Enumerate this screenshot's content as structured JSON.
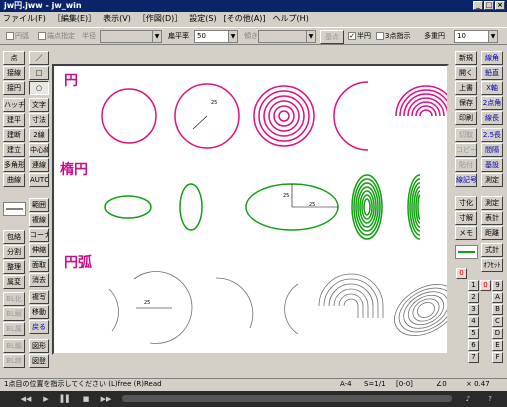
{
  "window": {
    "title": "jw円.jww - jw_win",
    "controls": [
      "_",
      "□",
      "×"
    ]
  },
  "menu": [
    "ファイル(F)",
    "［編集(E)］",
    "表示(V)",
    "［作図(D)］",
    "設定(S)",
    "[その他(A)]",
    "ヘルプ(H)"
  ],
  "toolbar": {
    "enkohai": "円弧",
    "tanten": "端点指定",
    "hankei": "半径",
    "henpei_label": "扁平率",
    "henpei_value": "50",
    "kakudo_label": "傾き",
    "sansho": "基点",
    "hanen": "半円",
    "sanshi": "3点指示",
    "taju_label": "多重円",
    "taju_value": "10"
  },
  "left_tools": [
    [
      "点",
      "／"
    ],
    [
      "接線",
      "□"
    ],
    [
      "接円",
      "○"
    ],
    [
      "ハッチ",
      "文字"
    ],
    [
      "建平",
      "寸法"
    ],
    [
      "建断",
      "2線"
    ],
    [
      "建立",
      "中心線"
    ],
    [
      "多角形",
      "連線"
    ],
    [
      "曲線",
      "AUTO"
    ],
    [
      "範囲"
    ],
    [
      "複線"
    ],
    [
      "包絡",
      "コーナー"
    ],
    [
      "分割",
      "伸縮"
    ],
    [
      "整理",
      "面取"
    ],
    [
      "属変",
      "消去"
    ],
    [
      "BL化",
      "複写"
    ],
    [
      "BL解",
      "移動"
    ],
    [
      "BL属",
      "戻る"
    ],
    [
      "BL編",
      "図形"
    ],
    [
      "BL終",
      "図登"
    ]
  ],
  "right_tools": [
    [
      "新規",
      "開く",
      "上書",
      "保存",
      "印刷",
      "切取",
      "コピー",
      "貼付",
      "線記号"
    ],
    [
      "線角",
      "鉛直",
      "X軸",
      "2点角",
      "線長",
      "2.5長",
      "間隔",
      "基設"
    ],
    [
      "寸化",
      "寸解",
      "メモ"
    ],
    [
      "測定",
      "表計",
      "距離",
      "式計",
      "ｵﾌｾｯﾄ"
    ]
  ],
  "right_tools_col1_extra": [
    "寸化",
    "寸解",
    "メモ"
  ],
  "numpad": [
    "0",
    "0",
    "1",
    "9",
    "2",
    "A",
    "3",
    "B",
    "4",
    "C",
    "5",
    "D",
    "6",
    "E",
    "7",
    "F"
  ],
  "canvas": {
    "headings": {
      "circle": "円",
      "ellipse": "楕円",
      "arc": "円弧"
    },
    "dim_labels": {
      "r1": "25",
      "e1": "25",
      "e2": "25",
      "a1": "25"
    }
  },
  "colors": {
    "circle": "#e0107c",
    "ellipse": "#10a010",
    "arc": "#707070",
    "heading": "#c8108c"
  },
  "status": {
    "message": "1点目の位置を指示してください (L)free (R)Read",
    "paper": "A-4",
    "scale": "S=1/1",
    "layer": "[0-0]",
    "angle": "∠0",
    "zoom": "× 0.47"
  }
}
